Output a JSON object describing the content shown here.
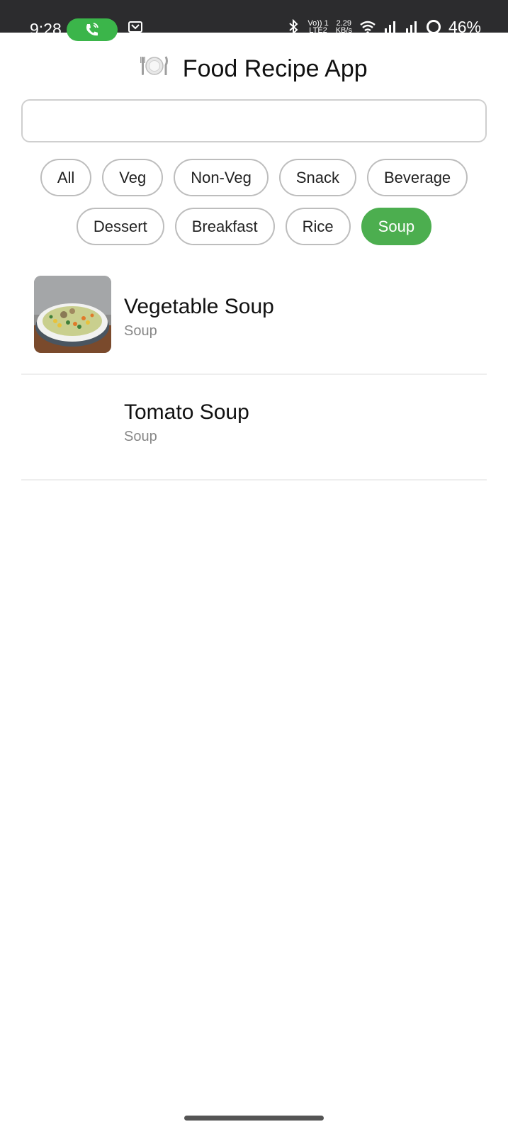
{
  "status_bar": {
    "time": "9:28",
    "network_top": "Vo)) 1",
    "network_bottom": "LTE2",
    "speed_top": "2.29",
    "speed_bottom": "KB/s",
    "battery": "46%"
  },
  "header": {
    "title": "Food Recipe App"
  },
  "search": {
    "value": "",
    "placeholder": ""
  },
  "categories": [
    {
      "label": "All",
      "active": false
    },
    {
      "label": "Veg",
      "active": false
    },
    {
      "label": "Non-Veg",
      "active": false
    },
    {
      "label": "Snack",
      "active": false
    },
    {
      "label": "Beverage",
      "active": false
    },
    {
      "label": "Dessert",
      "active": false
    },
    {
      "label": "Breakfast",
      "active": false
    },
    {
      "label": "Rice",
      "active": false
    },
    {
      "label": "Soup",
      "active": true
    }
  ],
  "recipes": [
    {
      "name": "Vegetable Soup",
      "category": "Soup",
      "thumbnail": "soup-bowl-photo"
    },
    {
      "name": "Tomato Soup",
      "category": "Soup",
      "thumbnail": ""
    }
  ],
  "colors": {
    "accent": "#4cae4f",
    "call_pill": "#3bb54a",
    "status_bar": "#2c2c2e"
  }
}
